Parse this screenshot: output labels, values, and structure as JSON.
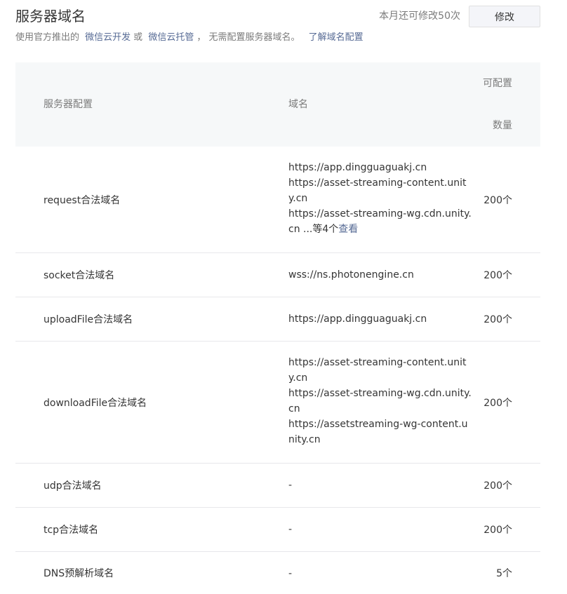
{
  "header": {
    "title": "服务器域名",
    "quota_text": "本月还可修改50次",
    "edit_label": "修改"
  },
  "description": {
    "prefix": "使用官方推出的",
    "link1": "微信云开发",
    "or": "或",
    "link2": "微信云托管",
    "suffix": "， 无需配置服务器域名。",
    "help_link": "了解域名配置"
  },
  "table": {
    "headers": {
      "config": "服务器配置",
      "domain": "域名",
      "count_line1": "可配置",
      "count_line2": "数量"
    },
    "rows": [
      {
        "name": "request合法域名",
        "domains": [
          "https://app.dingguaguakj.cn",
          "https://asset-streaming-content.unity.cn",
          "https://asset-streaming-wg.cdn.unity.cn"
        ],
        "more_text": " ...等4个",
        "more_link": "查看",
        "count": "200个"
      },
      {
        "name": "socket合法域名",
        "domains": [
          "wss://ns.photonengine.cn"
        ],
        "count": "200个"
      },
      {
        "name": "uploadFile合法域名",
        "domains": [
          "https://app.dingguaguakj.cn"
        ],
        "count": "200个"
      },
      {
        "name": "downloadFile合法域名",
        "domains": [
          "https://asset-streaming-content.unity.cn",
          "https://asset-streaming-wg.cdn.unity.cn",
          "https://assetstreaming-wg-content.unity.cn"
        ],
        "count": "200个"
      },
      {
        "name": "udp合法域名",
        "domains": [
          "-"
        ],
        "count": "200个"
      },
      {
        "name": "tcp合法域名",
        "domains": [
          "-"
        ],
        "count": "200个"
      },
      {
        "name": "DNS预解析域名",
        "domains": [
          "-"
        ],
        "count": "5个"
      }
    ]
  }
}
